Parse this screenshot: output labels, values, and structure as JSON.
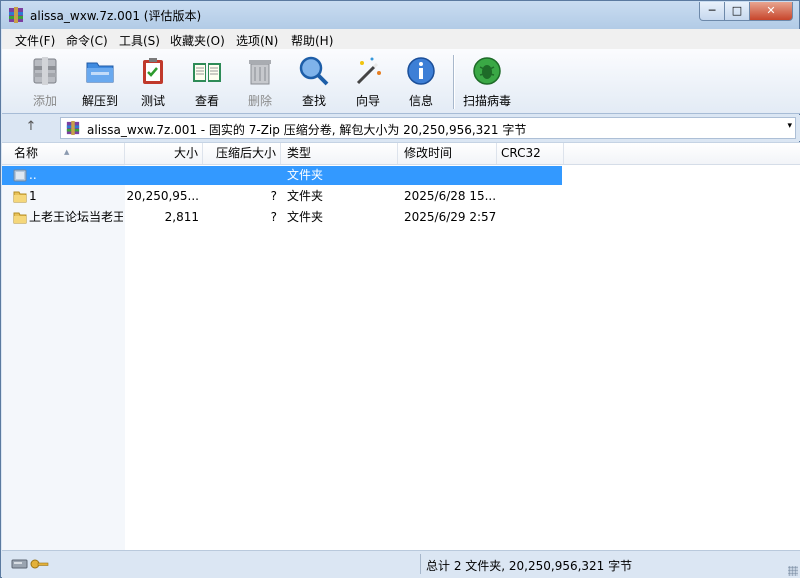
{
  "window": {
    "title": "alissa_wxw.7z.001 (评估版本)",
    "minimize_label": "─",
    "maximize_label": "□",
    "close_label": "✕"
  },
  "menu": [
    "文件(F)",
    "命令(C)",
    "工具(S)",
    "收藏夹(O)",
    "选项(N)",
    "帮助(H)"
  ],
  "toolbar": {
    "buttons": [
      {
        "label": "添加",
        "icon": "add-archive-icon",
        "enabled": false
      },
      {
        "label": "解压到",
        "icon": "extract-folder-icon",
        "enabled": true
      },
      {
        "label": "测试",
        "icon": "test-clipboard-icon",
        "enabled": true
      },
      {
        "label": "查看",
        "icon": "view-book-icon",
        "enabled": true
      },
      {
        "label": "删除",
        "icon": "trash-icon",
        "enabled": false
      },
      {
        "label": "查找",
        "icon": "magnifier-icon",
        "enabled": true
      },
      {
        "label": "向导",
        "icon": "wizard-wand-icon",
        "enabled": true
      },
      {
        "label": "信息",
        "icon": "info-icon",
        "enabled": true
      },
      {
        "label": "扫描病毒",
        "icon": "virus-scan-icon",
        "enabled": true
      }
    ]
  },
  "pathbar": {
    "up_icon": "up-arrow-icon",
    "text": "alissa_wxw.7z.001 - 固实的 7-Zip 压缩分卷, 解包大小为 20,250,956,321 字节",
    "dropdown_icon": "▾"
  },
  "columns": [
    "名称",
    "大小",
    "压缩后大小",
    "类型",
    "修改时间",
    "CRC32"
  ],
  "rows": [
    {
      "name": "..",
      "size": "",
      "packed": "",
      "type": "文件夹",
      "modified": "",
      "crc": "",
      "icon": "parent-folder-icon",
      "selected": true
    },
    {
      "name": "1",
      "size": "20,250,95...",
      "packed": "?",
      "type": "文件夹",
      "modified": "2025/6/28 15...",
      "crc": "",
      "icon": "folder-icon",
      "selected": false
    },
    {
      "name": "上老王论坛当老王",
      "size": "2,811",
      "packed": "?",
      "type": "文件夹",
      "modified": "2025/6/29 2:57",
      "crc": "",
      "icon": "folder-icon",
      "selected": false
    }
  ],
  "status": {
    "text": "总计 2 文件夹, 20,250,956,321 字节",
    "icons": [
      "drive-icon",
      "key-icon"
    ]
  },
  "colors": {
    "selection": "#3399ff",
    "frame": "#dbe6f3"
  }
}
